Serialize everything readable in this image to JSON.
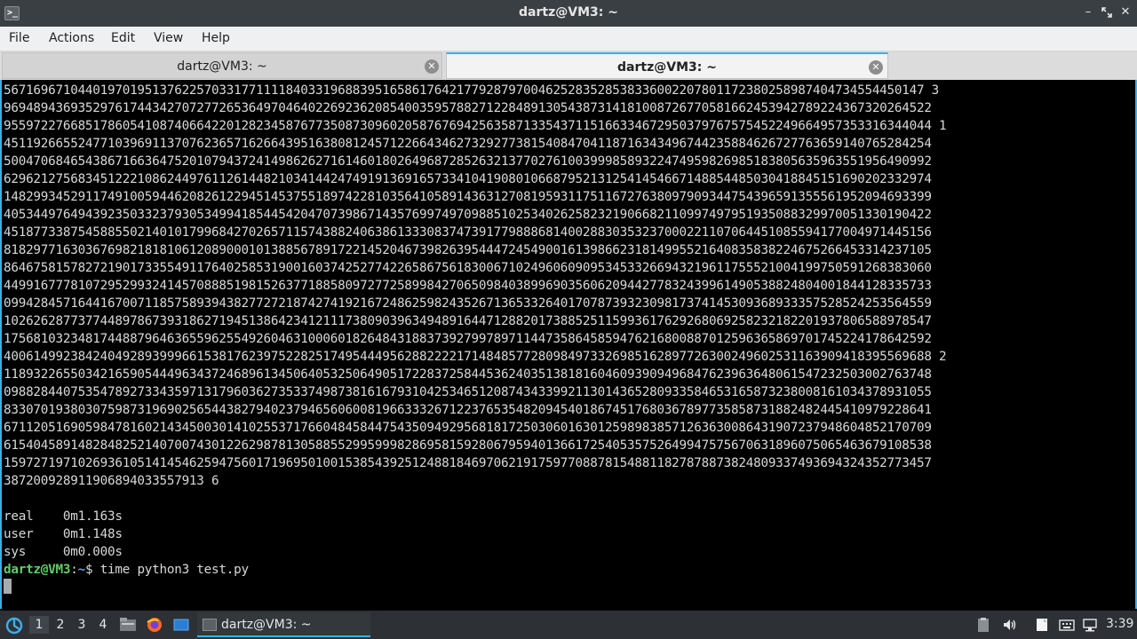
{
  "window": {
    "title": "dartz@VM3: ~",
    "app_icon_text": ">_"
  },
  "menu": {
    "file": "File",
    "actions": "Actions",
    "edit": "Edit",
    "view": "View",
    "help": "Help"
  },
  "tabs": [
    {
      "label": "dartz@VM3: ~"
    },
    {
      "label": "dartz@VM3: ~"
    }
  ],
  "terminal": {
    "output_lines": [
      "5671696710440197019513762257033177111184033196883951658617642177928797004625283528538336002207801172380258987404734554450147 3",
      "96948943693529761744342707277265364970464022692362085400359578827122848913054387314181008726770581662453942789224367320264522",
      "95597227668517860541087406642201282345876773508730960205876769425635871335437115166334672950379767575452249664957353316344044 1",
      "45119266552477103969113707623657162664395163808124571226643462732927738154084704118716343496744235884626727763659140765284254",
      "50047068465438671663647520107943724149862627161460180264968728526321377027610039998589322474959826985183805635963551956490992",
      "62962127568345122210862449761126144821034144247491913691657334104190801066879521312541454667148854485030418845151690202332974",
      "14829934529117491005944620826122945145375518974228103564105891436312708195931175116727638097909344754396591355561952094693399",
      "40534497649439235033237930534994185445420470739867143576997497098851025340262582321906682110997497951935088329970051330190422",
      "45187733875458855021401017996842702657115743882406386133308374739177988868140028830353237000221107064451085594177004971445156",
      "81829771630367698218181061208900010138856789172214520467398263954447245490016139866231814995521640835838224675266453314237105",
      "86467581578272190173355491176402585319001603742527742265867561830067102496060909534533266943219611755521004199750591268383060",
      "44991677781072952993241457088851981526377188580972772589984270650984038996903560620944277832439961490538824804001844128335733",
      "09942845716441670071185758939438277272187427419216724862598243526713653326401707873932309817374145309368933357528524253564559",
      "10262628773774489786739318627194513864234121117380903963494891644712882017388525115993617629268069258232182201937806588978547",
      "17568103234817448879646365596255492604631000601826484318837392799789711447358645859476216800887012596365869701745224178642592",
      "40061499238424049289399966153817623975228251749544495628822221714848577280984973326985162897726300249602531163909418395569688 2",
      "11893226550342165905444963437246896134506405325064905172283725844536240351381816046093909496847623963648061547232503002763748",
      "09882844075354789273343597131796036273533749873816167931042534651208743433992113014365280933584653165873238008161034378931055",
      "83307019380307598731969025654438279402379465606008196633326712237653548209454018674517680367897735858731882482445410979228641",
      "67112051690598478160214345003014102553717660484584475435094929568181725030601630125989838571263630086431907237948604852170709",
      "61540458914828482521407007430122629878130588552995999828695815928067959401366172540535752649947575670631896075065463679108538",
      "15972719710269361051414546259475601719695010015385439251248818469706219175977088781548811827878873824809337493694324352773457",
      "387200928911906894033557913 6"
    ],
    "timing": [
      {
        "label": "real",
        "value": "0m1.163s"
      },
      {
        "label": "user",
        "value": "0m1.148s"
      },
      {
        "label": "sys",
        "value": "0m0.000s"
      }
    ],
    "prompt_user": "dartz@VM3",
    "prompt_sep": ":",
    "prompt_path": "~",
    "prompt_symbol": "$",
    "command": "time python3 test.py"
  },
  "taskbar": {
    "workspaces": [
      "1",
      "2",
      "3",
      "4"
    ],
    "active_workspace": "1",
    "task_label": "dartz@VM3: ~",
    "clock": "3:39"
  },
  "colors": {
    "accent": "#3daee9",
    "prompt_user": "#5fd068",
    "prompt_path": "#5ea2ff"
  },
  "icons": [
    "start-menu-icon",
    "file-manager-icon",
    "firefox-icon",
    "terminal-icon",
    "clipboard-icon",
    "volume-icon",
    "notes-icon",
    "keyboard-icon",
    "network-icon"
  ]
}
